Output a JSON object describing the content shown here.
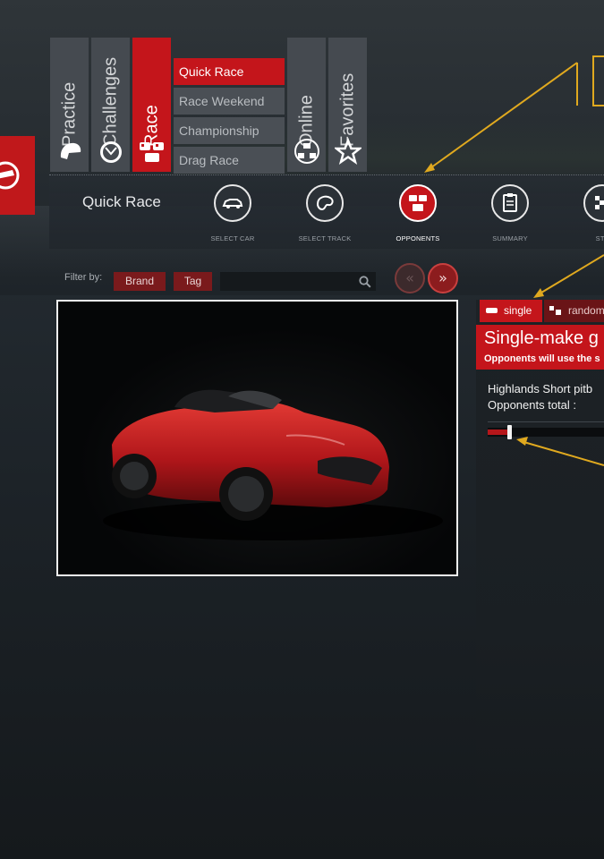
{
  "mode_tabs": [
    {
      "label": "Practice",
      "icon": "helmet-icon"
    },
    {
      "label": "Challenges",
      "icon": "stopwatch-icon"
    },
    {
      "label": "Race",
      "icon": "race-cars-icon"
    },
    {
      "label": "Online",
      "icon": "network-icon"
    },
    {
      "label": "Favorites",
      "icon": "star-icon"
    }
  ],
  "active_mode": "Race",
  "race_submenu": [
    "Quick Race",
    "Race Weekend",
    "Championship",
    "Drag Race"
  ],
  "active_submenu": "Quick Race",
  "content_title": "Quick Race",
  "steps": [
    {
      "label": "SELECT CAR",
      "icon": "car-icon"
    },
    {
      "label": "SELECT TRACK",
      "icon": "track-icon"
    },
    {
      "label": "OPPONENTS",
      "icon": "opponents-icon"
    },
    {
      "label": "SUMMARY",
      "icon": "clipboard-icon"
    },
    {
      "label": "STA",
      "icon": "checkered-flag-icon"
    }
  ],
  "active_step": "OPPONENTS",
  "filter": {
    "label": "Filter by:",
    "brand": "Brand",
    "tag": "Tag",
    "search_value": ""
  },
  "pager": {
    "prev": "«",
    "next": "»"
  },
  "opponents_panel": {
    "tab_single": "single",
    "tab_random": "random",
    "heading": "Single-make g",
    "subtext": "Opponents will use the s",
    "track_line": "Highlands Short pitb",
    "opponents_label": "Opponents total :",
    "opponents_fraction": 0.17
  },
  "colors": {
    "accent": "#c4151b",
    "annotation": "#e0a91f",
    "tab_inactive": "#454a50"
  }
}
